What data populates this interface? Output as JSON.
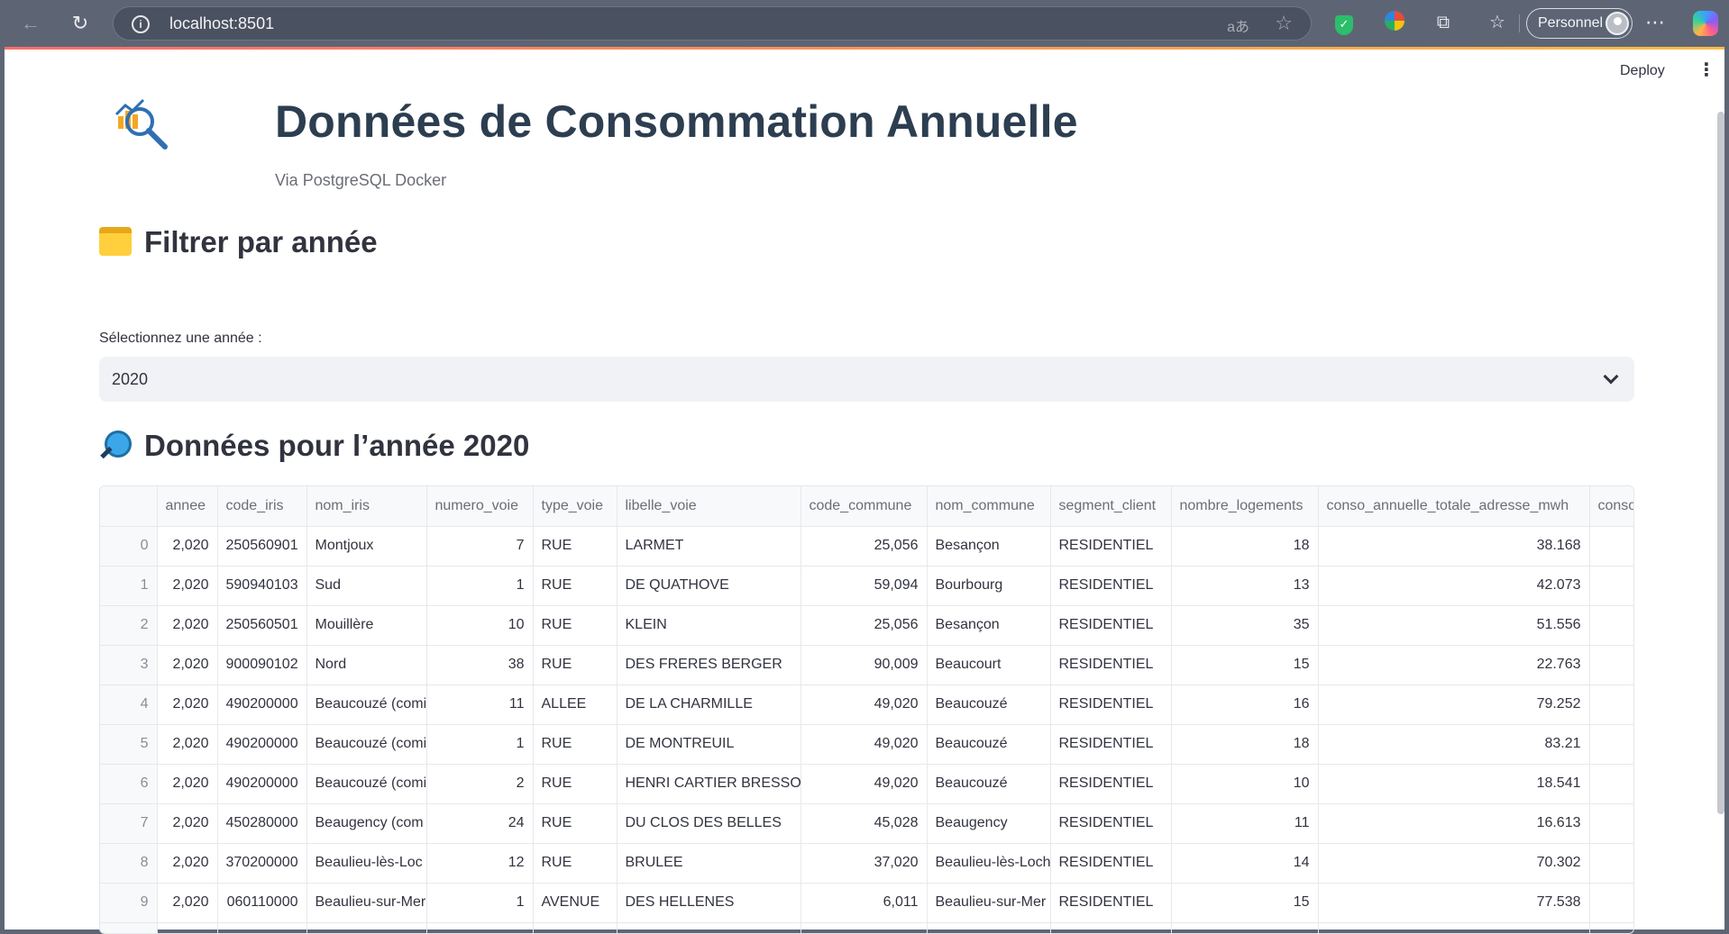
{
  "browser": {
    "url": "localhost:8501",
    "profile_label": "Personnel",
    "translate_glyph": "aあ",
    "icons": [
      "back-icon",
      "reload-icon",
      "info-icon",
      "translate-icon",
      "star-icon",
      "shield-extension-icon",
      "globe-extension-icon",
      "puzzle-icon",
      "favorites-icon",
      "profile-avatar-icon",
      "more-icon",
      "copilot-icon"
    ]
  },
  "app": {
    "deploy_label": "Deploy",
    "title": "Données de Consommation Annuelle",
    "subtitle": "Via PostgreSQL Docker",
    "filter_heading": "Filtrer par année",
    "select_label": "Sélectionnez une année :",
    "selected_year": "2020",
    "data_heading": "Données pour l’année 2020"
  },
  "table": {
    "columns": [
      "",
      "annee",
      "code_iris",
      "nom_iris",
      "numero_voie",
      "type_voie",
      "libelle_voie",
      "code_commune",
      "nom_commune",
      "segment_client",
      "nombre_logements",
      "conso_annuelle_totale_adresse_mwh",
      "conso"
    ],
    "rows": [
      [
        "0",
        "2,020",
        "250560901",
        "Montjoux",
        "7",
        "RUE",
        "LARMET",
        "25,056",
        "Besançon",
        "RESIDENTIEL",
        "18",
        "38.168",
        ""
      ],
      [
        "1",
        "2,020",
        "590940103",
        "Sud",
        "1",
        "RUE",
        "DE QUATHOVE",
        "59,094",
        "Bourbourg",
        "RESIDENTIEL",
        "13",
        "42.073",
        ""
      ],
      [
        "2",
        "2,020",
        "250560501",
        "Mouillère",
        "10",
        "RUE",
        "KLEIN",
        "25,056",
        "Besançon",
        "RESIDENTIEL",
        "35",
        "51.556",
        ""
      ],
      [
        "3",
        "2,020",
        "900090102",
        "Nord",
        "38",
        "RUE",
        "DES FRERES BERGER",
        "90,009",
        "Beaucourt",
        "RESIDENTIEL",
        "15",
        "22.763",
        ""
      ],
      [
        "4",
        "2,020",
        "490200000",
        "Beaucouzé (comi",
        "11",
        "ALLEE",
        "DE LA CHARMILLE",
        "49,020",
        "Beaucouzé",
        "RESIDENTIEL",
        "16",
        "79.252",
        ""
      ],
      [
        "5",
        "2,020",
        "490200000",
        "Beaucouzé (comi",
        "1",
        "RUE",
        "DE MONTREUIL",
        "49,020",
        "Beaucouzé",
        "RESIDENTIEL",
        "18",
        "83.21",
        ""
      ],
      [
        "6",
        "2,020",
        "490200000",
        "Beaucouzé (comi",
        "2",
        "RUE",
        "HENRI CARTIER BRESSON",
        "49,020",
        "Beaucouzé",
        "RESIDENTIEL",
        "10",
        "18.541",
        ""
      ],
      [
        "7",
        "2,020",
        "450280000",
        "Beaugency (com",
        "24",
        "RUE",
        "DU CLOS DES BELLES",
        "45,028",
        "Beaugency",
        "RESIDENTIEL",
        "11",
        "16.613",
        ""
      ],
      [
        "8",
        "2,020",
        "370200000",
        "Beaulieu-lès-Loc",
        "12",
        "RUE",
        "BRULEE",
        "37,020",
        "Beaulieu-lès-Loch",
        "RESIDENTIEL",
        "14",
        "70.302",
        ""
      ],
      [
        "9",
        "2,020",
        "060110000",
        "Beaulieu-sur-Mer",
        "1",
        "AVENUE",
        "DES HELLENES",
        "6,011",
        "Beaulieu-sur-Mer",
        "RESIDENTIEL",
        "15",
        "77.538",
        ""
      ]
    ]
  }
}
